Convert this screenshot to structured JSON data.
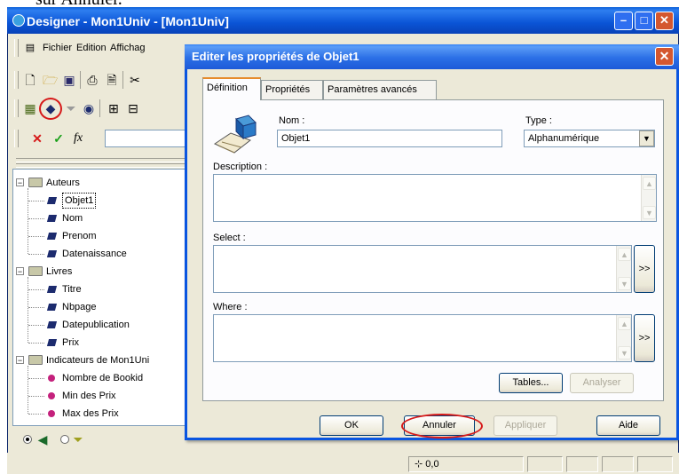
{
  "caption": "sur Annuler.",
  "window": {
    "title": "Designer - Mon1Univ - [Mon1Univ]"
  },
  "menu": [
    {
      "label": "Fichier"
    },
    {
      "label": "Edition"
    },
    {
      "label": "Affichag"
    }
  ],
  "tree": {
    "groups": [
      {
        "label": "Auteurs",
        "items": [
          "Objet1",
          "Nom",
          "Prenom",
          "Datenaissance"
        ]
      },
      {
        "label": "Livres",
        "items": [
          "Titre",
          "Nbpage",
          "Datepublication",
          "Prix"
        ]
      },
      {
        "label": "Indicateurs de Mon1Uni",
        "items": [
          "Nombre de Bookid",
          "Min des Prix",
          "Max des Prix"
        ]
      }
    ]
  },
  "statusbar": {
    "coords": "0,0"
  },
  "dialog": {
    "title": "Editer les propriétés de Objet1",
    "tabs": [
      "Définition",
      "Propriétés",
      "Paramètres avancés"
    ],
    "name_label": "Nom :",
    "name_value": "Objet1",
    "type_label": "Type :",
    "type_value": "Alphanumérique",
    "description_label": "Description :",
    "select_label": "Select :",
    "where_label": "Where :",
    "more_label": ">>",
    "tables_button": "Tables...",
    "analyze_button": "Analyser",
    "ok_button": "OK",
    "cancel_button": "Annuler",
    "apply_button": "Appliquer",
    "help_button": "Aide"
  },
  "colors": {
    "title_blue": "#0a54d6",
    "highlight_red": "#d61a1a",
    "measure_magenta": "#c4217c"
  }
}
